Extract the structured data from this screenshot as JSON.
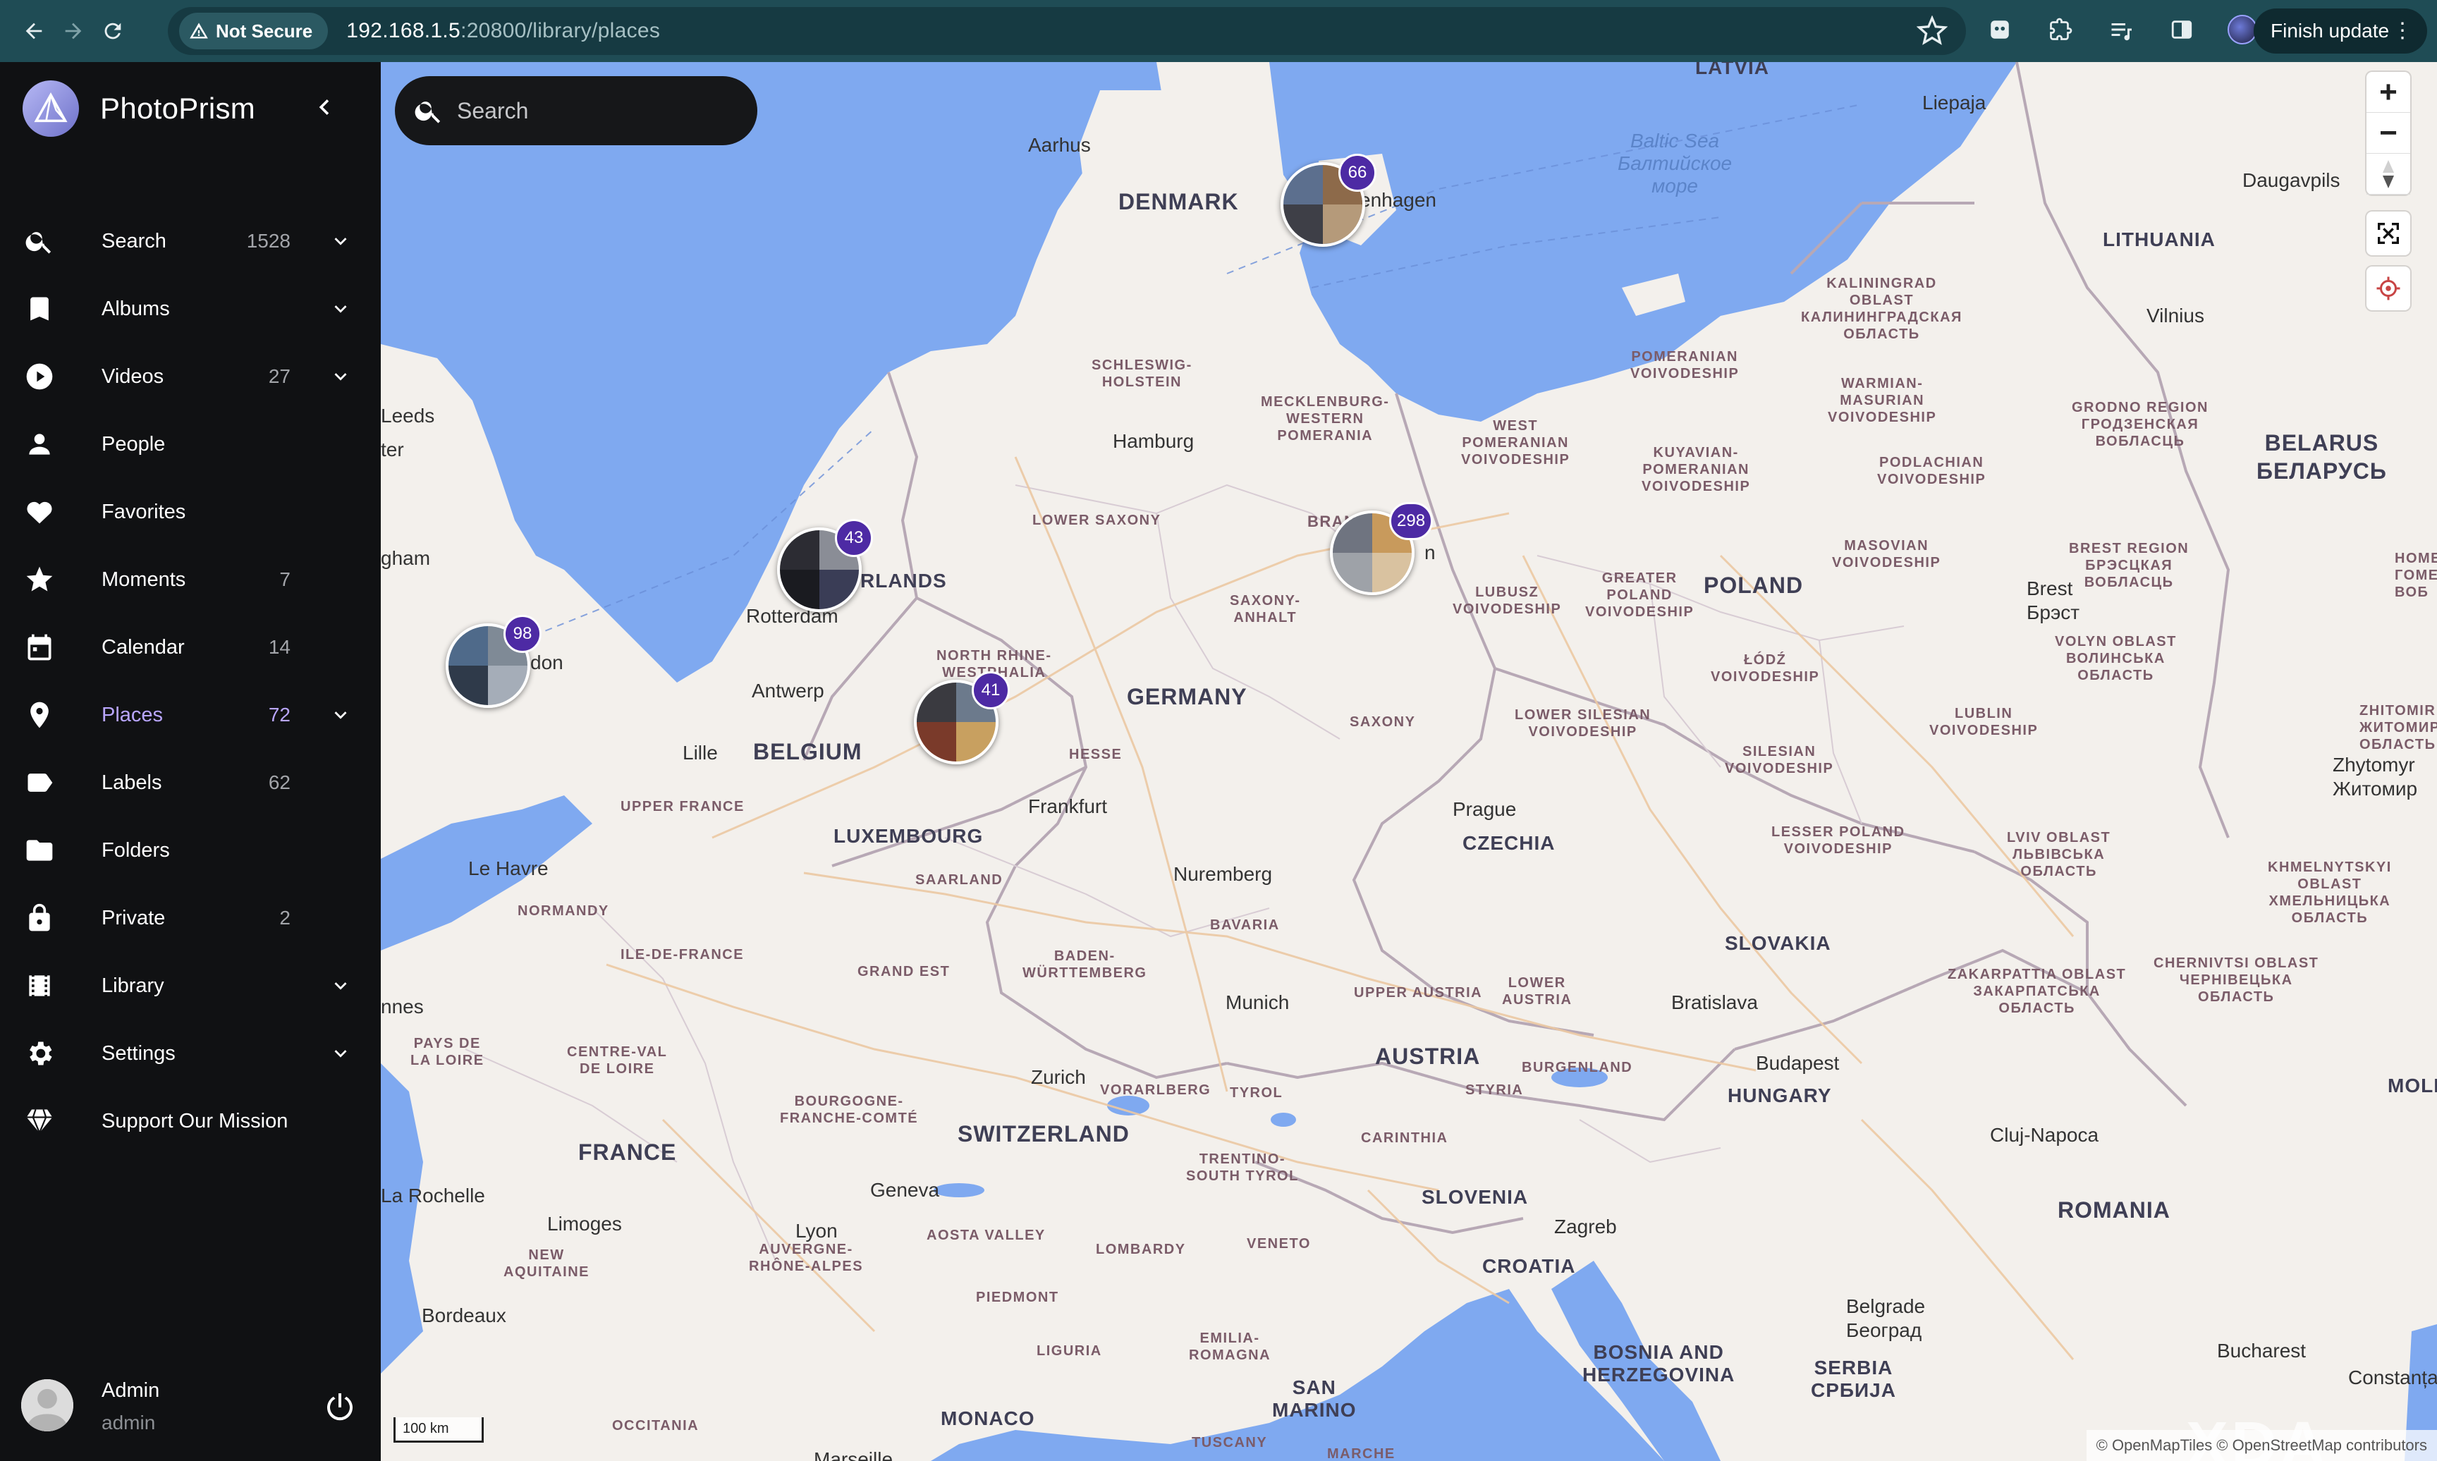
{
  "browser": {
    "security_label": "Not Secure",
    "url_host": "192.168.1.5",
    "url_rest": ":20800/library/places",
    "finish_update_label": "Finish update"
  },
  "app": {
    "name": "PhotoPrism"
  },
  "sidebar": {
    "items": [
      {
        "label": "Search",
        "count": "1528",
        "icon": "search-icon",
        "expandable": true
      },
      {
        "label": "Albums",
        "count": "",
        "icon": "bookmark-icon",
        "expandable": true
      },
      {
        "label": "Videos",
        "count": "27",
        "icon": "play-circle-icon",
        "expandable": true
      },
      {
        "label": "People",
        "count": "",
        "icon": "person-icon",
        "expandable": false
      },
      {
        "label": "Favorites",
        "count": "",
        "icon": "heart-icon",
        "expandable": false
      },
      {
        "label": "Moments",
        "count": "7",
        "icon": "star-icon",
        "expandable": false
      },
      {
        "label": "Calendar",
        "count": "14",
        "icon": "calendar-icon",
        "expandable": false
      },
      {
        "label": "Places",
        "count": "72",
        "icon": "location-pin-icon",
        "expandable": true,
        "active": true
      },
      {
        "label": "Labels",
        "count": "62",
        "icon": "tag-icon",
        "expandable": false
      },
      {
        "label": "Folders",
        "count": "",
        "icon": "folder-icon",
        "expandable": false
      },
      {
        "label": "Private",
        "count": "2",
        "icon": "lock-icon",
        "expandable": false
      },
      {
        "label": "Library",
        "count": "",
        "icon": "film-icon",
        "expandable": true
      },
      {
        "label": "Settings",
        "count": "",
        "icon": "gear-icon",
        "expandable": true
      },
      {
        "label": "Support Our Mission",
        "count": "",
        "icon": "diamond-icon",
        "expandable": false
      }
    ],
    "user": {
      "name": "Admin",
      "login": "admin"
    }
  },
  "map": {
    "search_placeholder": "Search",
    "scale_label": "100 km",
    "attribution": "© OpenMapTiles © OpenStreetMap contributors",
    "clusters": [
      {
        "count": "66",
        "place": "Copenhagen"
      },
      {
        "count": "43",
        "place": "Netherlands"
      },
      {
        "count": "298",
        "place": "Berlin"
      },
      {
        "count": "98",
        "place": "London"
      },
      {
        "count": "41",
        "place": "North Rhine-Westphalia"
      }
    ],
    "labels": {
      "latvia": "LATVIA",
      "liepaja": "Liepaja",
      "aarhus": "Aarhus",
      "denmark": "DENMARK",
      "copenhagen": "enhagen",
      "baltic": "Baltic Sea",
      "baltic_ru1": "Балтийское",
      "baltic_ru2": "море",
      "daugavpils": "Daugavpils",
      "lithuania": "LITHUANIA",
      "vilnius": "Vilnius",
      "kalin1": "KALININGRAD",
      "kalin2": "OBLAST",
      "kalin3": "КАЛИНИНГРАДСКАЯ",
      "kalin4": "ОБЛАСТЬ",
      "schleswig1": "SCHLESWIG-",
      "schleswig2": "HOLSTEIN",
      "meck1": "MECKLENBURG-",
      "meck2": "WESTERN",
      "meck3": "POMERANIA",
      "pom1": "POMERANIAN",
      "pom2": "VOIVODESHIP",
      "warmian1": "WARMIAN-",
      "warmian2": "MASURIAN",
      "warmian3": "VOIVODESHIP",
      "grodno1": "GRODNO REGION",
      "grodno2": "ГРОДЗЕНСКАЯ",
      "grodno3": "ВОБЛАСЦЬ",
      "belarus1": "BELARUS",
      "belarus2": "БЕЛАРУСЬ",
      "leeds": "Leeds",
      "hamburg": "Hamburg",
      "wpom1": "WEST",
      "wpom2": "POMERANIAN",
      "wpom3": "VOIVODESHIP",
      "kuyav1": "KUYAVIAN-",
      "kuyav2": "POMERANIAN",
      "kuyav3": "VOIVODESHIP",
      "podl1": "PODLACHIAN",
      "podl2": "VOIVODESHIP",
      "gham": "gham",
      "ter": "ter",
      "lowsax": "LOWER SAXONY",
      "brand": "BRAN",
      "berlin_tail": "n",
      "nl": "RLANDS",
      "rotterdam": "Rotterdam",
      "saxanh1": "SAXONY-",
      "saxanh2": "ANHALT",
      "lubusz1": "LUBUSZ",
      "lubusz2": "VOIVODESHIP",
      "gpol1": "GREATER",
      "gpol2": "POLAND",
      "gpol3": "VOIVODESHIP",
      "poland": "POLAND",
      "masov1": "MASOVIAN",
      "masov2": "VOIVODESHIP",
      "brest1": "BREST REGION",
      "brest2": "БРЭСЦКАЯ",
      "brest3": "ВОБЛАСЦЬ",
      "brest_city1": "Brest",
      "brest_city2": "Брэст",
      "home1": "HOME",
      "home2": "ГОМЕ",
      "home3": "ВОБ",
      "london": "don",
      "nrw1": "NORTH RHINE-",
      "nrw2": "WESTPHALIA",
      "antwerp": "Antwerp",
      "germany": "GERMANY",
      "lodz1": "ŁÓDŹ",
      "lodz2": "VOIVODESHIP",
      "volyn1": "VOLYN OBLAST",
      "volyn2": "ВОЛИНСЬКА",
      "volyn3": "ОБЛАСТЬ",
      "zhyt1": "ZHITOMIR OBLAS",
      "zhyt2": "ЖИТОМИРСЬКА",
      "zhyt3": "ОБЛАСТЬ",
      "lille": "Lille",
      "belgium": "BELGIUM",
      "hesse": "HESSE",
      "saxony": "SAXONY",
      "lsil1": "LOWER SILESIAN",
      "lsil2": "VOIVODESHIP",
      "sil1": "SILESIAN",
      "sil2": "VOIVODESHIP",
      "lublin1": "LUBLIN",
      "lublin2": "VOIVODESHIP",
      "zhytomyr1": "Zhytomyr",
      "zhytomyr2": "Житомир",
      "upfr": "UPPER FRANCE",
      "frankfurt": "Frankfurt",
      "prague": "Prague",
      "lux": "LUXEMBOURG",
      "czechia": "CZECHIA",
      "lessp1": "LESSER POLAND",
      "lessp2": "VOIVODESHIP",
      "lviv1": "LVIV OBLAST",
      "lviv2": "ЛЬВІВСЬКА",
      "lviv3": "ОБЛАСТЬ",
      "lehavre": "Le Havre",
      "saarland": "SAARLAND",
      "nuremberg": "Nuremberg",
      "khm1": "KHMELNYTSKYI",
      "khm2": "OBLAST",
      "khm3": "ХМЕЛЬНИЦЬКА",
      "khm4": "ОБЛАСТЬ",
      "normandy": "NORMANDY",
      "bavaria": "BAVARIA",
      "slovakia": "SLOVAKIA",
      "idf": "ILE-DE-FRANCE",
      "bw1": "BADEN-",
      "bw2": "WÜRTTEMBERG",
      "zak1": "ZAKARPATTIA OBLAST",
      "zak2": "ЗАКАРПАТСЬКА",
      "zak3": "ОБЛАСТЬ",
      "chern1": "CHERNIVTSI OBLAST",
      "chern2": "ЧЕРНІВЕЦЬКА",
      "chern3": "ОБЛАСТЬ",
      "grandest": "GRAND EST",
      "upaus": "UPPER AUSTRIA",
      "lowaus1": "LOWER",
      "lowaus2": "AUSTRIA",
      "nnes": "nnes",
      "munich": "Munich",
      "bratislava": "Bratislava",
      "pdl1": "PAYS DE",
      "pdl2": "LA LOIRE",
      "cvl1": "CENTRE-VAL",
      "cvl2": "DE LOIRE",
      "austria": "AUSTRIA",
      "burgenland": "BURGENLAND",
      "budapest": "Budapest",
      "bfc1": "BOURGOGNE-",
      "bfc2": "FRANCHE-COMTÉ",
      "zurich": "Zurich",
      "vorarlberg": "VORARLBERG",
      "tyrol": "TYROL",
      "styria": "STYRIA",
      "hungary": "HUNGARY",
      "moldova": "MOLDOVA",
      "switzerland": "SWITZERLAND",
      "carinthia": "CARINTHIA",
      "cluj": "Cluj-Napoca",
      "france": "FRANCE",
      "trentino1": "TRENTINO-",
      "trentino2": "SOUTH TYROL",
      "larochelle": "La Rochelle",
      "geneva": "Geneva",
      "slovenia": "SLOVENIA",
      "romania": "ROMANIA",
      "limoges": "Limoges",
      "lyon": "Lyon",
      "aosta": "AOSTA VALLEY",
      "lombardy": "LOMBARDY",
      "veneto": "VENETO",
      "zagreb": "Zagreb",
      "na1": "NEW",
      "na2": "AQUITAINE",
      "ara1": "AUVERGNE-",
      "ara2": "RHÔNE-ALPES",
      "croatia": "CROATIA",
      "piedmont": "PIEDMONT",
      "belgrade1": "Belgrade",
      "belgrade2": "Београд",
      "bordeaux": "Bordeaux",
      "er1": "EMILIA-",
      "er2": "ROMAGNA",
      "bih1": "BOSNIA AND",
      "bih2": "HERZEGOVINA",
      "serbia1": "SERBIA",
      "serbia2": "СРБИЈА",
      "liguria": "LIGURIA",
      "bucharest": "Bucharest",
      "constanta": "Constanța",
      "sm1": "SAN",
      "sm2": "MARINO",
      "monaco": "MONACO",
      "occitania": "OCCITANIA",
      "tuscany": "TUSCANY",
      "marche": "MARCHE",
      "marseille": "Marseille"
    }
  }
}
